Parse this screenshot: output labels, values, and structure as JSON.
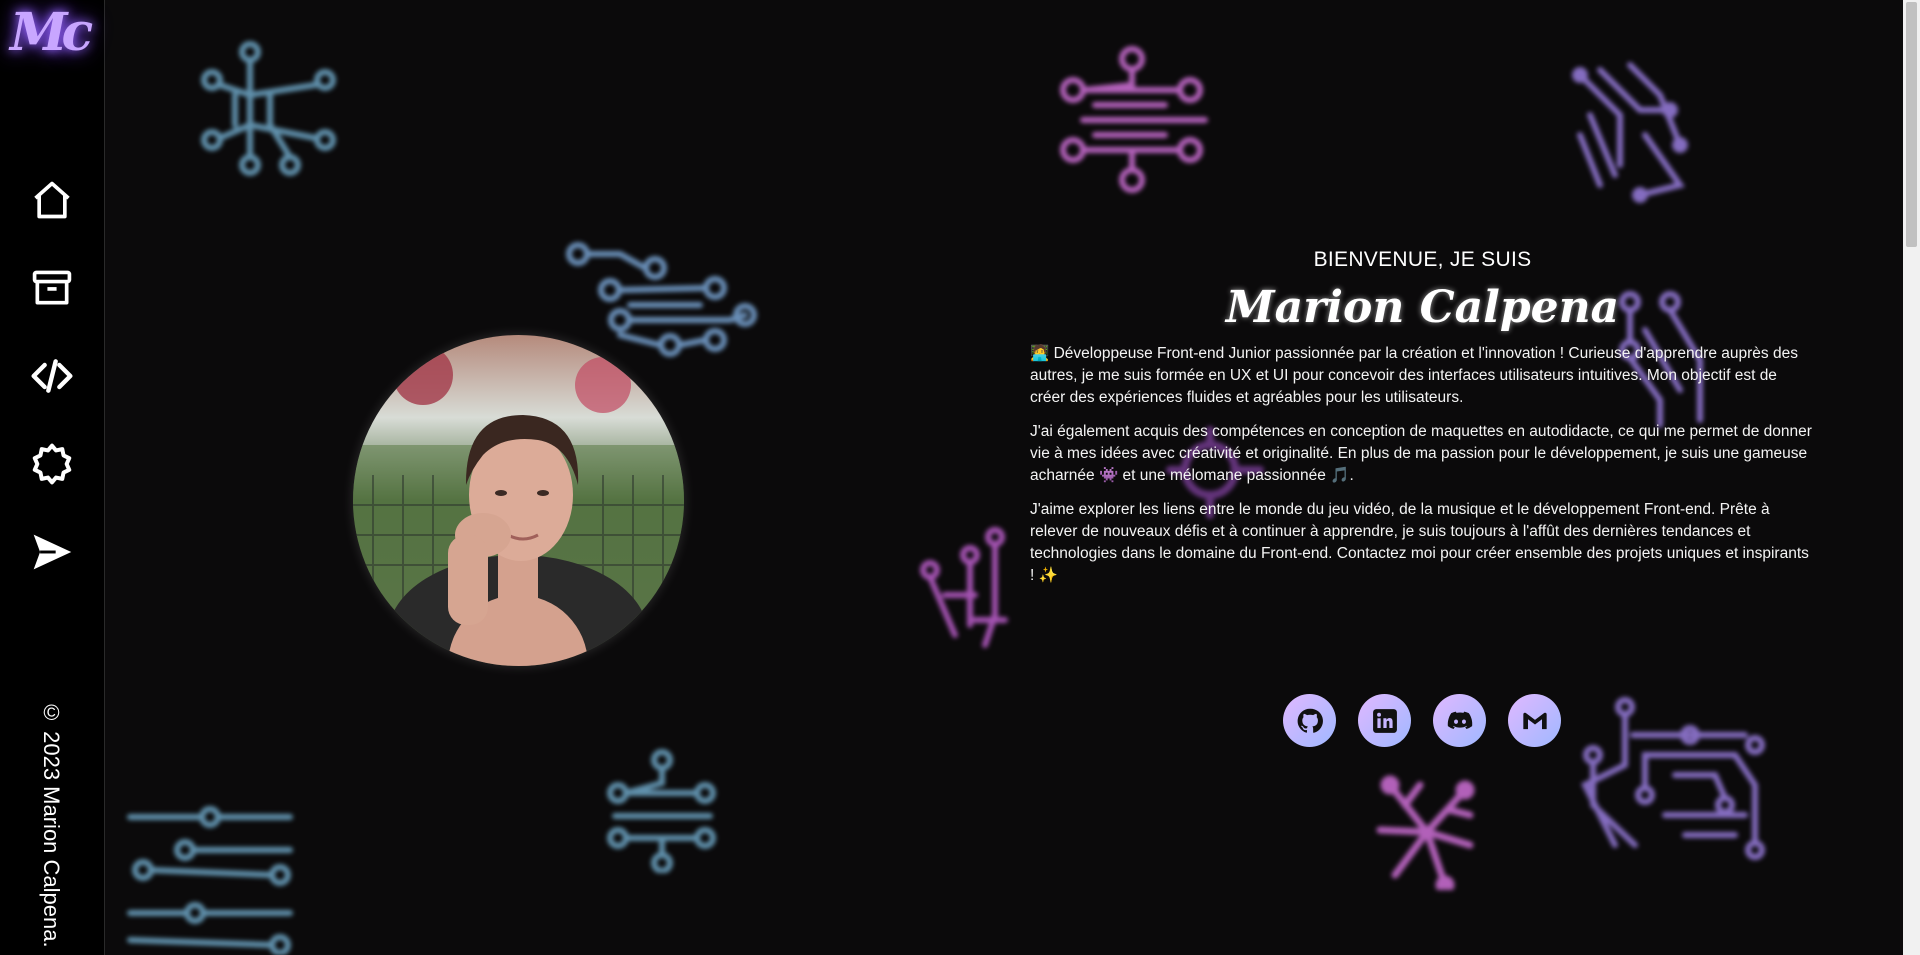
{
  "logo": {
    "text": "Mc"
  },
  "sidebar": {
    "items": [
      {
        "icon": "home-icon",
        "label": "Accueil"
      },
      {
        "icon": "archive-icon",
        "label": "Projets"
      },
      {
        "icon": "code-icon",
        "label": "Compétences"
      },
      {
        "icon": "gear-icon",
        "label": "Paramètres"
      },
      {
        "icon": "send-icon",
        "label": "Contact"
      }
    ],
    "copyright": "© 2023 Marion Calpena."
  },
  "hero": {
    "welcome": "BIENVENUE, JE SUIS",
    "name": "Marion Calpena",
    "bio": [
      "🧑‍💻 Développeuse Front-end Junior passionnée par la création et l'innovation ! Curieuse d'apprendre auprès des autres, je me suis formée en UX et UI pour concevoir des interfaces utilisateurs intuitives. Mon objectif est de créer des expériences fluides et agréables pour les utilisateurs.",
      "J'ai également acquis des compétences en conception de maquettes en autodidacte, ce qui me permet de donner vie à mes idées avec créativité et originalité. En plus de ma passion pour le développement, je suis une gameuse acharnée 👾 et une mélomane passionnée 🎵.",
      "J'aime explorer les liens entre le monde du jeu vidéo, de la musique et le développement Front-end. Prête à relever de nouveaux défis et à continuer à apprendre, je suis toujours à l'affût des dernières tendances et technologies dans le domaine du Front-end. Contactez moi pour créer ensemble des projets uniques et inspirants ! ✨"
    ]
  },
  "socials": [
    {
      "icon": "github-icon",
      "label": "GitHub"
    },
    {
      "icon": "linkedin-icon",
      "label": "LinkedIn"
    },
    {
      "icon": "discord-icon",
      "label": "Discord"
    },
    {
      "icon": "gmail-icon",
      "label": "Gmail"
    }
  ],
  "colors": {
    "background": "#0b0a0b",
    "accent_purple": "#c8a6ff",
    "circuit_blue": "#6fa8c8",
    "circuit_pink": "#d070d8",
    "circuit_violet": "#9a7ee0"
  }
}
